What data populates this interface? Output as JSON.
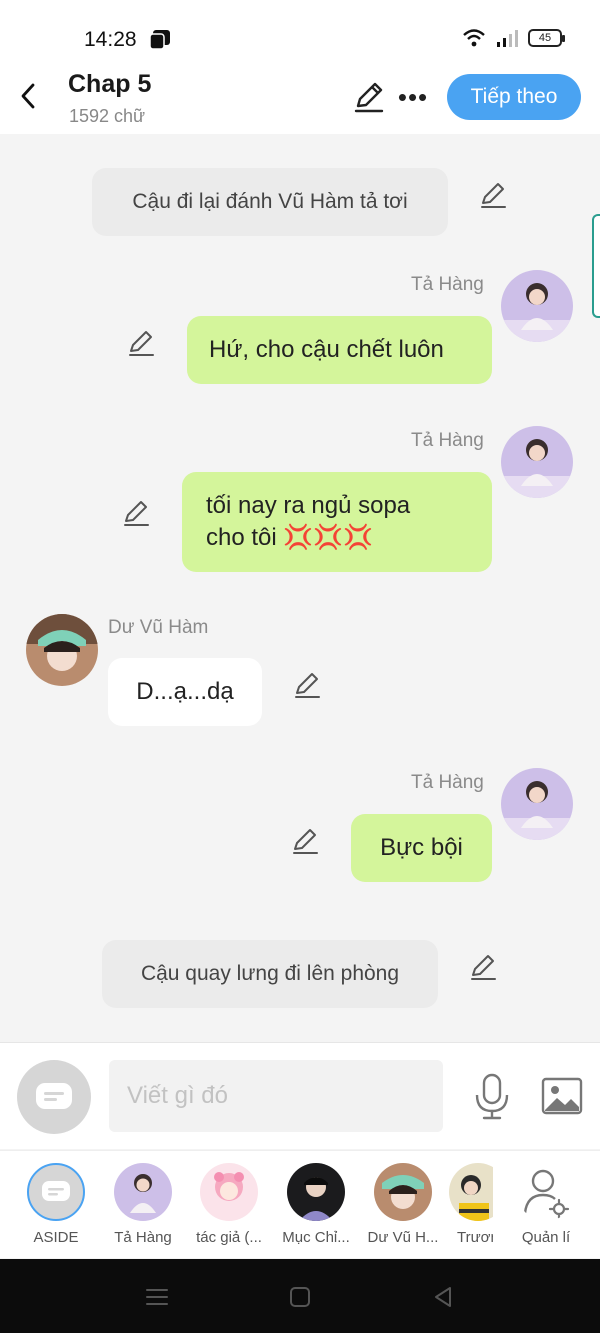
{
  "status_bar": {
    "time": "14:28",
    "battery": "45"
  },
  "header": {
    "title": "Chap 5",
    "word_count": "1592 chữ",
    "next_label": "Tiếp theo"
  },
  "messages": [
    {
      "type": "narration",
      "text": "Cậu đi lại đánh Vũ Hàm tả tơi"
    },
    {
      "type": "right",
      "speaker": "Tả Hàng",
      "text": "Hứ, cho cậu chết luôn"
    },
    {
      "type": "right",
      "speaker": "Tả Hàng",
      "line1": "tối nay ra ngủ sopa",
      "line2": "cho tôi 💢💢💢"
    },
    {
      "type": "left",
      "speaker": "Dư Vũ Hàm",
      "text": "D...ạ...dạ"
    },
    {
      "type": "right",
      "speaker": "Tả Hàng",
      "text": "Bực bội"
    },
    {
      "type": "narration",
      "text": "Cậu quay lưng đi lên phòng"
    }
  ],
  "composer": {
    "placeholder": "Viết gì đó"
  },
  "characters": [
    {
      "label": "ASIDE"
    },
    {
      "label": "Tả Hàng"
    },
    {
      "label": "tác giả (..."
    },
    {
      "label": "Mục Chỉ..."
    },
    {
      "label": "Dư Vũ H..."
    },
    {
      "label": "Trươn"
    },
    {
      "label": "Quản lí"
    }
  ],
  "colors": {
    "accent": "#4aa3f2",
    "bubble_right": "#d4f59b",
    "bubble_left": "#ffffff",
    "narration": "#ebebeb"
  }
}
